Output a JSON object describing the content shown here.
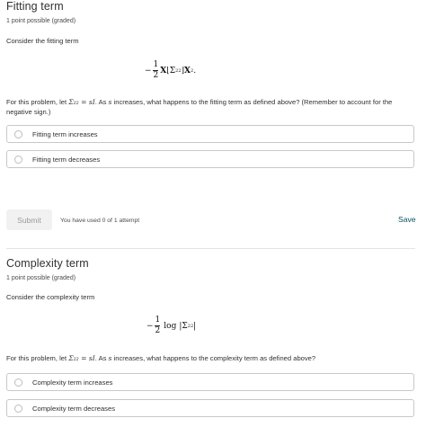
{
  "problem1": {
    "title": "Fitting term",
    "points": "1 point possible (graded)",
    "intro": "Consider the fitting term",
    "formula": {
      "sign": "−",
      "frac_num": "1",
      "frac_den": "2",
      "expr": "X",
      "bracket_l": "⌊",
      "sigma": "Σ",
      "sigma_sub": "22",
      "bracket_r": "⌋",
      "expr2": "X",
      "expr2_sub": "2",
      "end": "."
    },
    "question_prefix": "For this problem, let ",
    "question_math": "Σ₂₂ = sI",
    "question_mid": ". As ",
    "question_var": "s",
    "question_suffix": " increases, what happens to the fitting term as defined above? (Remember to account for the negative sign.)",
    "options": [
      "Fitting term increases",
      "Fitting term decreases"
    ],
    "submit_label": "Submit",
    "attempts_text": "You have used 0 of 1 attempt",
    "save_label": "Save"
  },
  "problem2": {
    "title": "Complexity term",
    "points": "1 point possible (graded)",
    "intro": "Consider the complexity term",
    "formula": {
      "sign": "−",
      "frac_num": "1",
      "frac_den": "2",
      "log": "log",
      "abs_open": "|",
      "sigma": "Σ",
      "sigma_sub": "22",
      "abs_close": "|"
    },
    "question_prefix": "For this problem, let ",
    "question_math": "Σ₂₂ = sI",
    "question_mid": ". As ",
    "question_var": "s",
    "question_suffix": " increases, what happens to the complexity term as defined above?",
    "options": [
      "Complexity term increases",
      "Complexity term decreases"
    ]
  },
  "colors": {
    "text": "#313131",
    "border": "#c8c8c8",
    "save_link": "#0b4f63",
    "submit_bg": "#f1f1f1"
  }
}
